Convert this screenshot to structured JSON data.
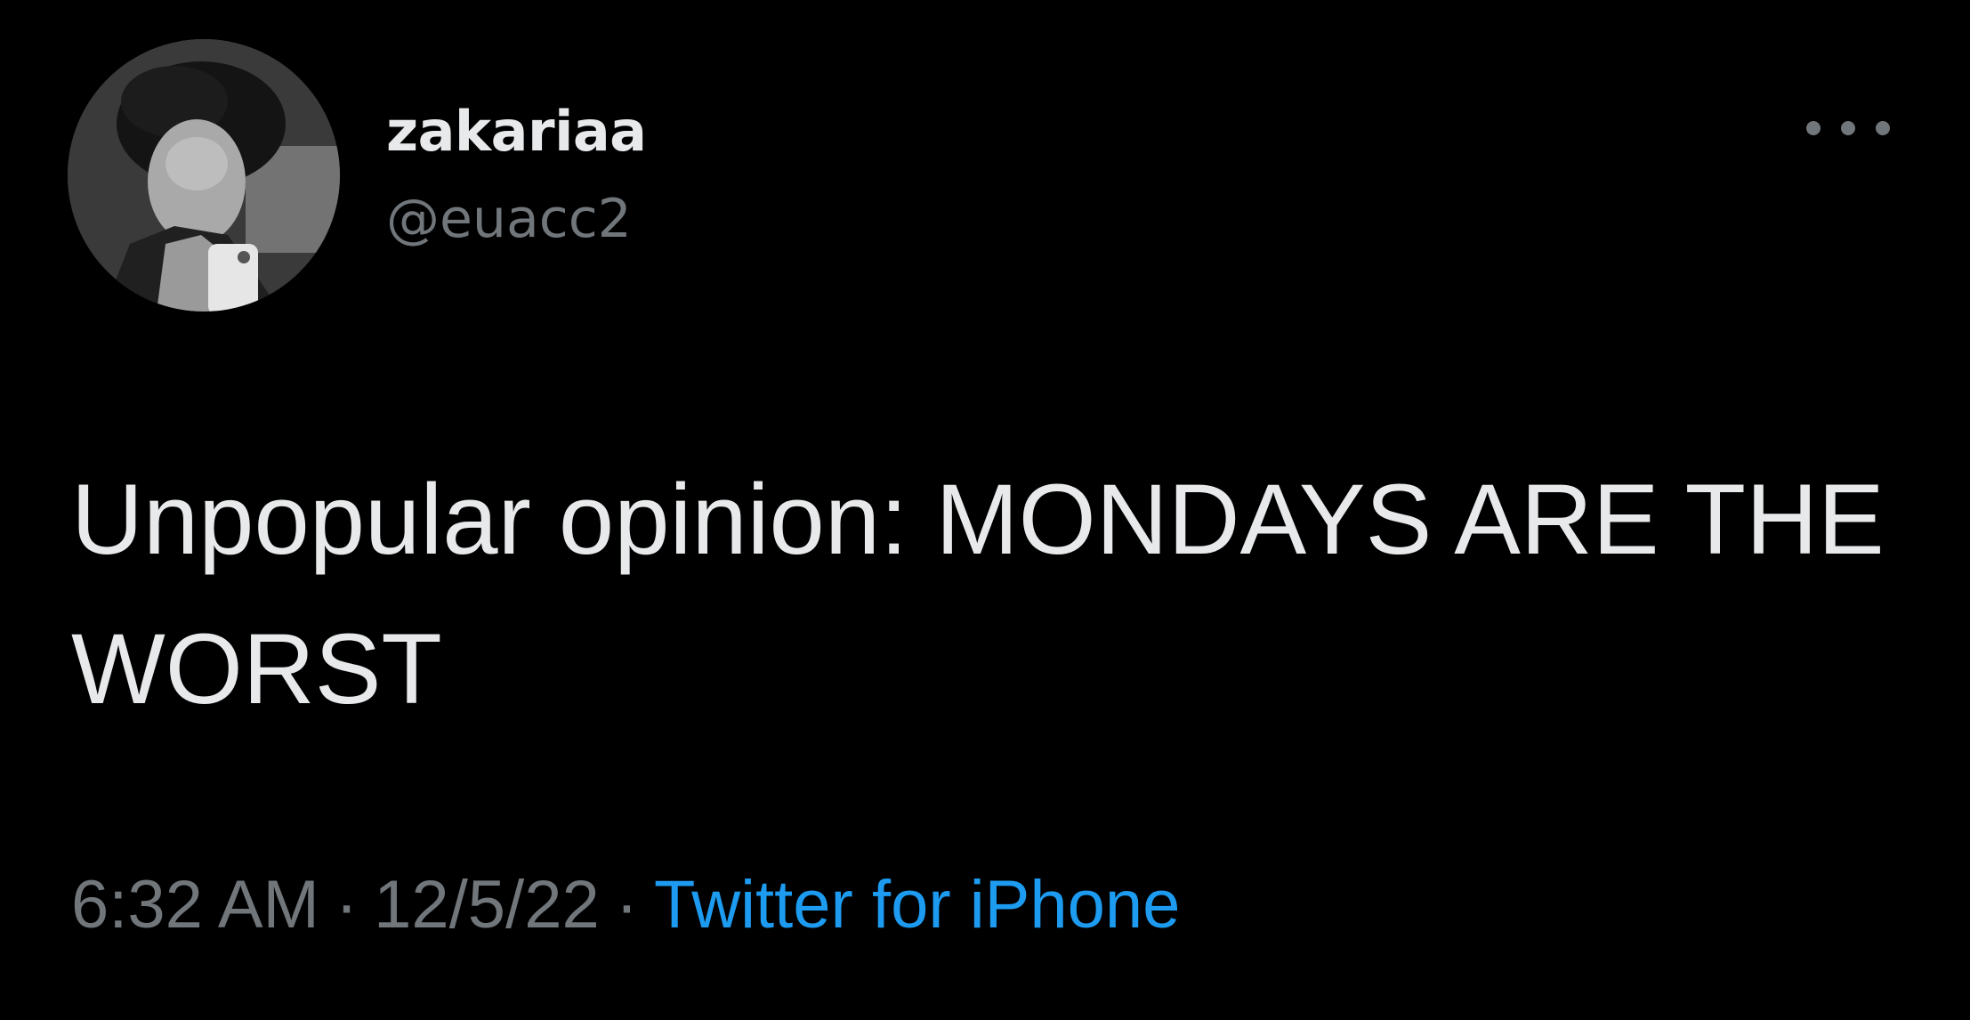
{
  "tweet": {
    "author": {
      "display_name": "zakariaa",
      "handle": "@euacc2"
    },
    "text": "Unpopular opinion: MONDAYS ARE THE WORST",
    "time": "6:32 AM",
    "date": "12/5/22",
    "separator": "·",
    "source": "Twitter for iPhone"
  },
  "icons": {
    "more": "more-horizontal-icon",
    "avatar": "profile-photo"
  },
  "colors": {
    "background": "#000000",
    "text_primary": "#e7e9ea",
    "text_secondary": "#71767b",
    "link": "#1d9bf0"
  }
}
